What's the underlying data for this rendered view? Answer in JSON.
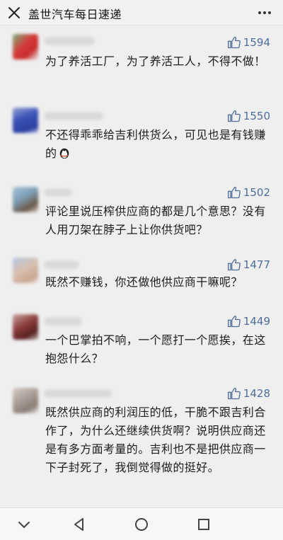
{
  "header": {
    "title": "盖世汽车每日速递",
    "close_icon": "close-icon",
    "more_icon": "more-icon"
  },
  "comments": [
    {
      "likes": "1594",
      "text": "为了养活工厂，为了养活工人，不得不做！",
      "avatar_color": "#d43a3a"
    },
    {
      "likes": "1550",
      "text": "不还得乖乖给吉利供货么，可见也是有钱赚的",
      "emoji": "qq-penguin-emoji",
      "avatar_color": "#3b52b8"
    },
    {
      "likes": "1502",
      "text": "评论里说压榨供应商的都是几个意思？没有人用刀架在脖子上让你供货吧？",
      "avatar_color": "#7fa0b8"
    },
    {
      "likes": "1477",
      "text": "既然不赚钱，你还做他供应商干嘛呢？",
      "avatar_color": "#c9b3a6"
    },
    {
      "likes": "1449",
      "text": "一个巴掌拍不响，一个愿打一个愿挨，在这抱怨什么？",
      "avatar_color": "#8a3a3a"
    },
    {
      "likes": "1428",
      "text": "既然供应商的利润压的低，干脆不跟吉利合作了，为什么还继续供货啊？说明供应商还是有多方面考量的。吉利也不是把供应商一下子封死了，我倒觉得做的挺好。",
      "avatar_color": "#a89d97"
    }
  ],
  "navbar": {
    "icons": [
      "chevron-down-icon",
      "back-triangle-icon",
      "home-circle-icon",
      "recent-square-icon"
    ]
  }
}
